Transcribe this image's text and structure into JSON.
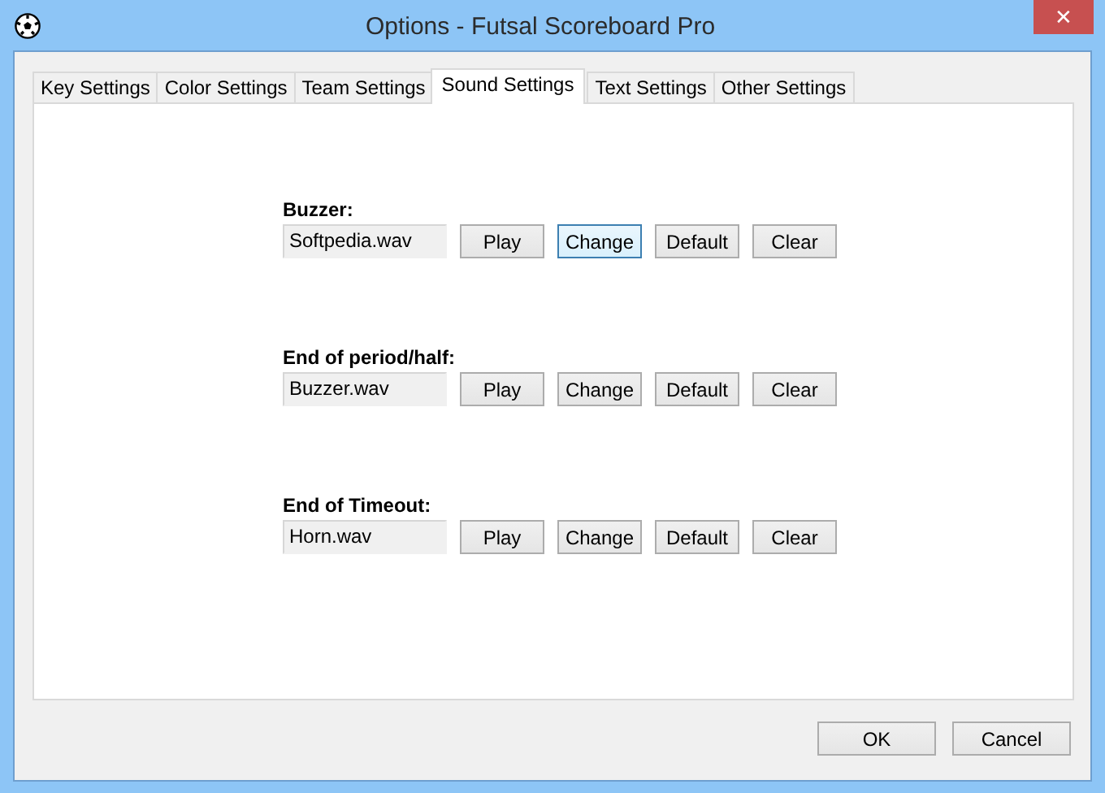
{
  "window": {
    "title": "Options - Futsal Scoreboard Pro",
    "close": "✕"
  },
  "tabs": [
    {
      "label": "Key Settings",
      "selected": false
    },
    {
      "label": "Color Settings",
      "selected": false
    },
    {
      "label": "Team Settings",
      "selected": false
    },
    {
      "label": "Sound Settings",
      "selected": true
    },
    {
      "label": "Text Settings",
      "selected": false
    },
    {
      "label": "Other Settings",
      "selected": false
    }
  ],
  "sounds": [
    {
      "label": "Buzzer:",
      "file": "Softpedia.wav",
      "buttons": [
        {
          "label": "Play",
          "focused": false
        },
        {
          "label": "Change",
          "focused": true
        },
        {
          "label": "Default",
          "focused": false
        },
        {
          "label": "Clear",
          "focused": false
        }
      ]
    },
    {
      "label": "End of period/half:",
      "file": "Buzzer.wav",
      "buttons": [
        {
          "label": "Play",
          "focused": false
        },
        {
          "label": "Change",
          "focused": false
        },
        {
          "label": "Default",
          "focused": false
        },
        {
          "label": "Clear",
          "focused": false
        }
      ]
    },
    {
      "label": "End of Timeout:",
      "file": "Horn.wav",
      "buttons": [
        {
          "label": "Play",
          "focused": false
        },
        {
          "label": "Change",
          "focused": false
        },
        {
          "label": "Default",
          "focused": false
        },
        {
          "label": "Clear",
          "focused": false
        }
      ]
    }
  ],
  "buttons": [
    "OK",
    "Cancel"
  ]
}
